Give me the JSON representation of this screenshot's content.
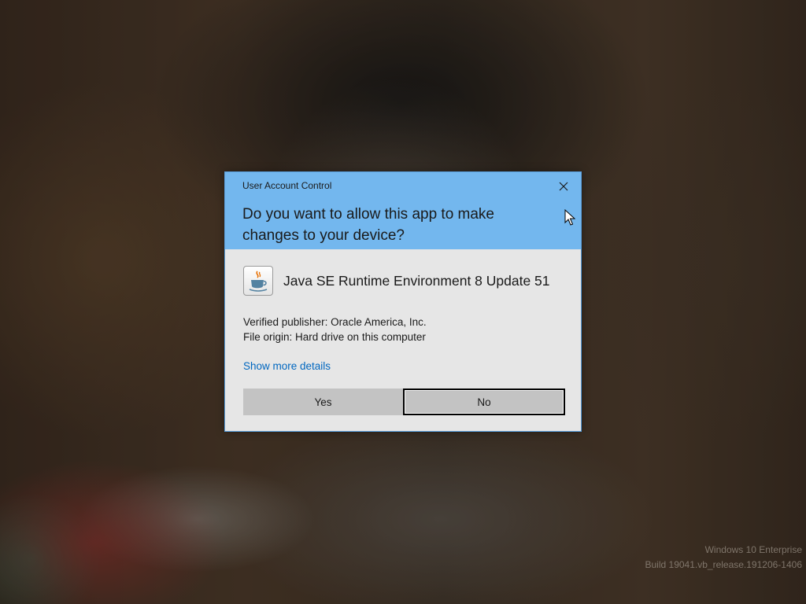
{
  "dialog": {
    "caption": "User Account Control",
    "question": "Do you want to allow this app to make changes to your device?",
    "app_name": "Java SE Runtime Environment 8 Update 51",
    "app_icon": "java-coffee-cup-icon",
    "publisher_line": "Verified publisher: Oracle America, Inc.",
    "origin_line": "File origin: Hard drive on this computer",
    "show_more_link": "Show more details",
    "yes_label": "Yes",
    "no_label": "No",
    "header_color": "#73b7ee",
    "link_color": "#0067c0"
  },
  "watermark": {
    "edition": "Windows 10 Enterprise",
    "build": "Build 19041.vb_release.191206-1406"
  }
}
